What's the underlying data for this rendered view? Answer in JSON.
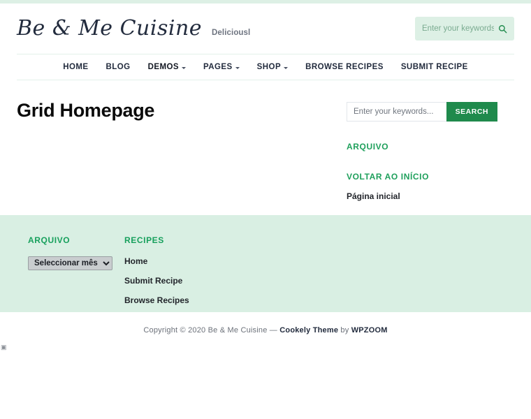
{
  "header": {
    "site_title": "Be & Me Cuisine",
    "tagline": "Deliciousl",
    "search": {
      "placeholder": "Enter your keywords...",
      "value": "",
      "icon": "search-icon"
    }
  },
  "nav": {
    "items": [
      {
        "label": "HOME",
        "has_dropdown": false,
        "active": false
      },
      {
        "label": "BLOG",
        "has_dropdown": false,
        "active": false
      },
      {
        "label": "DEMOS",
        "has_dropdown": true,
        "active": true
      },
      {
        "label": "PAGES",
        "has_dropdown": true,
        "active": false
      },
      {
        "label": "SHOP",
        "has_dropdown": true,
        "active": false
      },
      {
        "label": "BROWSE RECIPES",
        "has_dropdown": false,
        "active": false
      },
      {
        "label": "SUBMIT RECIPE",
        "has_dropdown": false,
        "active": false
      }
    ]
  },
  "main": {
    "page_title": "Grid Homepage"
  },
  "sidebar": {
    "search": {
      "placeholder": "Enter your keywords...",
      "value": "",
      "button_label": "SEARCH"
    },
    "widgets": [
      {
        "title": "ARQUIVO",
        "links": []
      },
      {
        "title": "VOLTAR AO INÍCIO",
        "links": [
          {
            "label": "Página inicial"
          }
        ]
      }
    ]
  },
  "footer": {
    "widgets": [
      {
        "title": "ARQUIVO",
        "select_value": "Seleccionar mês"
      },
      {
        "title": "RECIPES",
        "links": [
          {
            "label": "Home"
          },
          {
            "label": "Submit Recipe"
          },
          {
            "label": "Browse Recipes"
          }
        ]
      }
    ],
    "copyright": {
      "prefix": "Copyright © 2020 Be & Me Cuisine — ",
      "theme": "Cookely Theme",
      "middle": " by ",
      "vendor": "WPZOOM"
    },
    "stray_glyph": "▣"
  },
  "colors": {
    "accent_green": "#1fa05c",
    "button_green": "#1f8a4c",
    "mint_bg": "#d9efe3",
    "header_search_bg": "#ddf0e5",
    "dark_text": "#222b3d"
  }
}
